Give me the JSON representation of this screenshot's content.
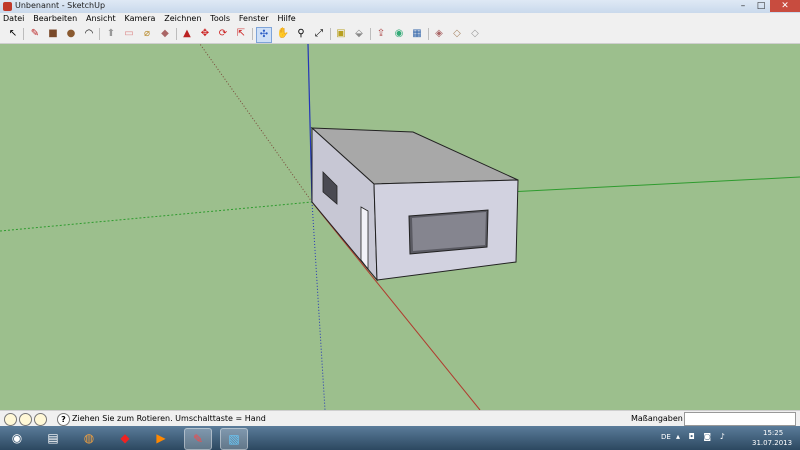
{
  "window": {
    "title": "Unbenannt - SketchUp",
    "min": "–",
    "max": "□",
    "close": "✕"
  },
  "menu": [
    "Datei",
    "Bearbeiten",
    "Ansicht",
    "Kamera",
    "Zeichnen",
    "Tools",
    "Fenster",
    "Hilfe"
  ],
  "toolbar": [
    {
      "name": "select-icon",
      "glyph": "↖"
    },
    {
      "name": "pencil-icon",
      "glyph": "✎"
    },
    {
      "name": "rectangle-icon",
      "glyph": "■"
    },
    {
      "name": "circle-icon",
      "glyph": "●"
    },
    {
      "name": "arc-icon",
      "glyph": "◠"
    },
    {
      "name": "push-pull-icon",
      "glyph": "⬆"
    },
    {
      "name": "eraser-icon",
      "glyph": "▭"
    },
    {
      "name": "tape-measure-icon",
      "glyph": "⌀"
    },
    {
      "name": "paint-bucket-icon",
      "glyph": "◆"
    },
    {
      "name": "push-pull-tool-icon",
      "glyph": "▲"
    },
    {
      "name": "move-icon",
      "glyph": "✥"
    },
    {
      "name": "rotate-icon",
      "glyph": "⟳"
    },
    {
      "name": "offset-icon",
      "glyph": "⇱"
    },
    {
      "name": "orbit-icon",
      "glyph": "✣"
    },
    {
      "name": "pan-icon",
      "glyph": "✋"
    },
    {
      "name": "zoom-icon",
      "glyph": "⚲"
    },
    {
      "name": "zoom-extents-icon",
      "glyph": "⤢"
    },
    {
      "name": "components-icon",
      "glyph": "▣"
    },
    {
      "name": "3d-warehouse-icon",
      "glyph": "⬙"
    },
    {
      "name": "share-model-icon",
      "glyph": "⇪"
    },
    {
      "name": "google-earth-icon",
      "glyph": "◉"
    },
    {
      "name": "get-models-icon",
      "glyph": "▦"
    },
    {
      "name": "place-model-icon",
      "glyph": "◈"
    },
    {
      "name": "extension-icon",
      "glyph": "◇"
    }
  ],
  "status": {
    "hint": "Ziehen Sie zum Rotieren.  Umschalttaste = Hand",
    "measure_label": "Maßangaben",
    "measure_value": ""
  },
  "taskbar": {
    "apps": [
      {
        "name": "start-button",
        "glyph": "◉"
      },
      {
        "name": "explorer-icon",
        "glyph": "▤"
      },
      {
        "name": "firefox-icon",
        "glyph": "◍"
      },
      {
        "name": "app-icon",
        "glyph": "◆"
      },
      {
        "name": "media-player-icon",
        "glyph": "▶"
      },
      {
        "name": "sketchup-icon",
        "glyph": "✎"
      },
      {
        "name": "layout-icon",
        "glyph": "▧"
      }
    ],
    "lang": "DE",
    "time": "15:25",
    "date": "31.07.2013"
  },
  "colors": {
    "viewport": "#9cbf8d",
    "axis_red": "#b03a2e",
    "axis_green": "#2e9b2e",
    "axis_blue": "#2436b8"
  }
}
